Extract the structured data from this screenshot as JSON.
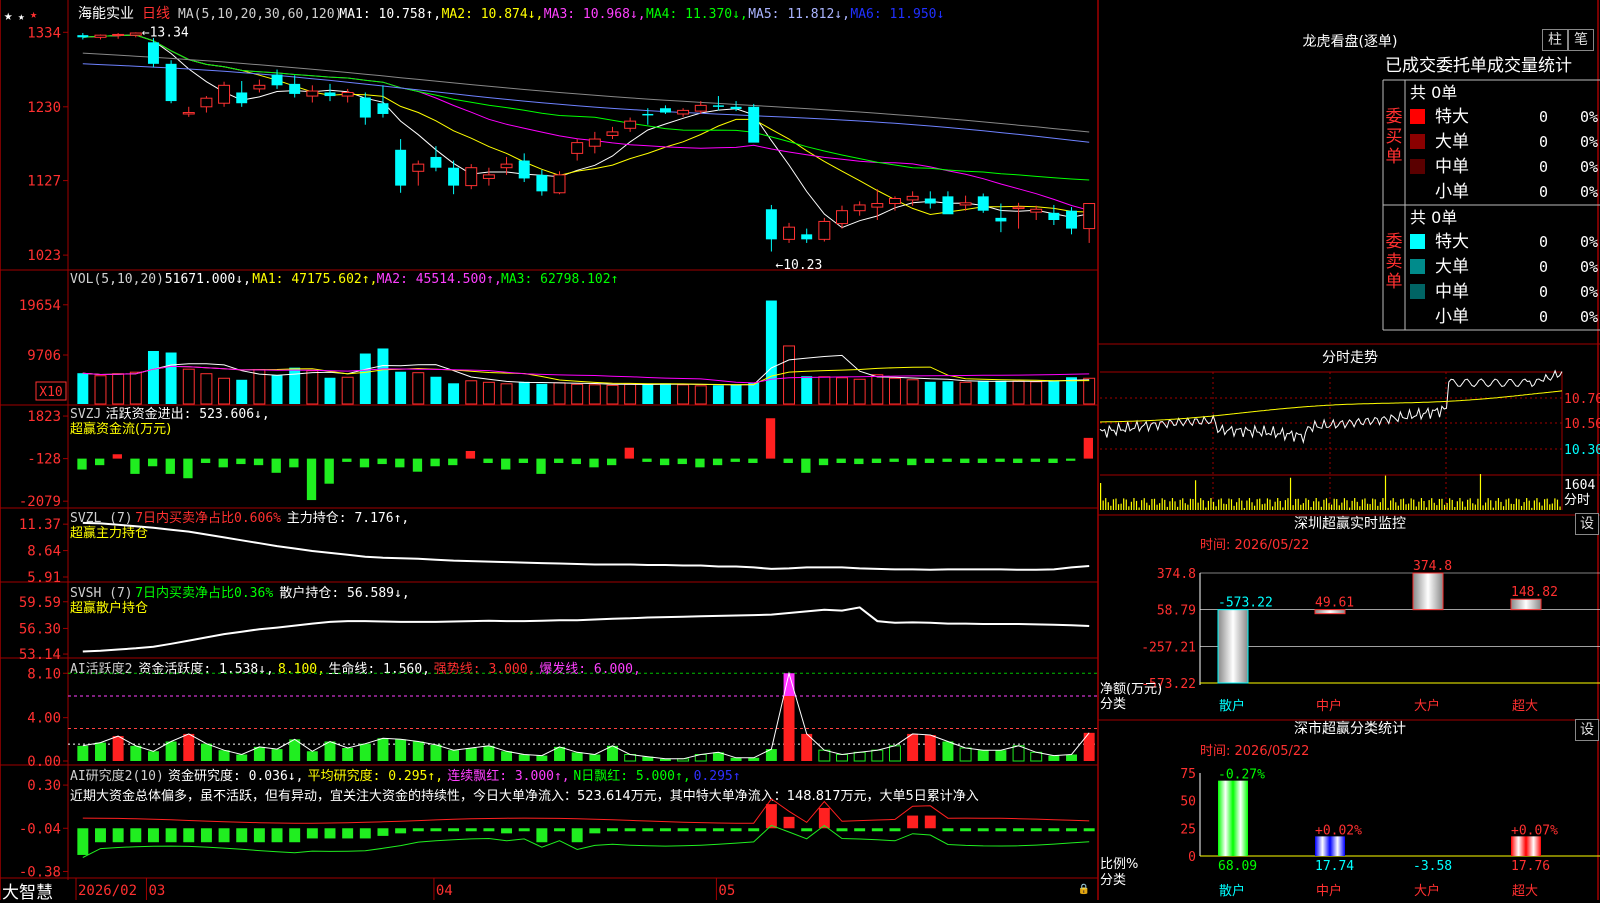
{
  "app": {
    "brand": "大智慧"
  },
  "stock": {
    "name": "海能实业",
    "period": "日线"
  },
  "colors": {
    "up": "#ff3232",
    "down": "#00ffff",
    "bg": "#000000",
    "grid": "#a00000",
    "ma1": "#ffffff",
    "ma2": "#ffff00",
    "ma3": "#ff00ff",
    "ma4": "#00ff00",
    "ma5": "#6e82ff",
    "ma6": "#888888"
  },
  "price_panel": {
    "header": [
      {
        "t": "MA(5,10,20,30,60,120)",
        "c": "#d0d0d0"
      },
      {
        "t": "MA1: 10.758↑,",
        "c": "#ffffff"
      },
      {
        "t": "MA2: 10.874↓,",
        "c": "#ffff00"
      },
      {
        "t": "MA3: 10.968↓,",
        "c": "#ff40ff"
      },
      {
        "t": "MA4: 11.370↓,",
        "c": "#00ff00"
      },
      {
        "t": "MA5: 11.812↓,",
        "c": "#aab4ff"
      },
      {
        "t": "MA6: 11.950↓",
        "c": "#2030ff"
      }
    ],
    "ticks": [
      "1334",
      "1230",
      "1127",
      "1023"
    ],
    "ymin": 10.05,
    "ymax": 13.4,
    "high_label": "13.34",
    "low_label": "←10.23"
  },
  "vol_panel": {
    "header": [
      {
        "t": "VOL(5,10,20)",
        "c": "#d0d0d0"
      },
      {
        "t": "51671.000↓,",
        "c": "#ffffff"
      },
      {
        "t": "MA1: 47175.602↑,",
        "c": "#ffff00"
      },
      {
        "t": "MA2: 45514.500↑,",
        "c": "#ff40ff"
      },
      {
        "t": "MA3: 62798.102↑",
        "c": "#00ff00"
      }
    ],
    "ticks": [
      "19654",
      "9706"
    ],
    "unit": "X10",
    "max": 21000
  },
  "svzj_panel": {
    "header": [
      {
        "t": "SVZJ",
        "c": "#d0d0d0"
      },
      {
        "t": "活跃资金进出: 523.606↓,",
        "c": "#ffffff"
      }
    ],
    "subtitle": "超赢资金流(万元)",
    "ticks": [
      "1823",
      "-128",
      "-2079"
    ],
    "min": -2300,
    "max": 2100
  },
  "svzl_panel": {
    "header": [
      {
        "t": "SVZL (7)",
        "c": "#d0d0d0"
      },
      {
        "t": "7日内买卖净占比0.606%",
        "c": "#ff3030"
      },
      {
        "t": "主力持仓: 7.176↑,",
        "c": "#ffffff"
      }
    ],
    "subtitle": "超赢主力持仓",
    "ticks": [
      "11.37",
      "8.64",
      "5.91"
    ],
    "min": 5.6,
    "max": 11.8
  },
  "svsh_panel": {
    "header": [
      {
        "t": "SVSH (7)",
        "c": "#d0d0d0"
      },
      {
        "t": "7日内买卖净占比0.36%",
        "c": "#00ff00"
      },
      {
        "t": "散户持仓: 56.589↓,",
        "c": "#ffffff"
      }
    ],
    "subtitle": "超赢散户持仓",
    "ticks": [
      "59.59",
      "56.30",
      "53.14"
    ],
    "min": 52.9,
    "max": 60.3
  },
  "ai_panel": {
    "header": [
      {
        "t": "AI活跃度2",
        "c": "#d0d0d0"
      },
      {
        "t": "资金活跃度: 1.538↓,",
        "c": "#ffffff"
      },
      {
        "t": "8.100,",
        "c": "#ffff00"
      },
      {
        "t": "生命线: 1.560,",
        "c": "#ffffff"
      },
      {
        "t": "强势线: 3.000,",
        "c": "#ff3030"
      },
      {
        "t": "爆发线: 6.000,",
        "c": "#ff40ff"
      }
    ],
    "ticks": [
      "8.10",
      "4.00",
      "0.00"
    ],
    "min": 0,
    "max": 8.4
  },
  "research_panel": {
    "header": [
      {
        "t": "AI研究度2(10)",
        "c": "#d0d0d0"
      },
      {
        "t": "资金研究度: 0.036↓,",
        "c": "#ffffff"
      },
      {
        "t": "平均研究度: 0.295↑,",
        "c": "#ffff00"
      },
      {
        "t": "连续飘红: 3.000↑,",
        "c": "#ff40ff"
      },
      {
        "t": "N日飘红: 5.000↑,",
        "c": "#00ff00"
      },
      {
        "t": "0.295↑",
        "c": "#3030ff"
      }
    ],
    "note": "近期大资金总体偏多，虽不活跃，但有异动，宜关注大资金的持续性，今日大单净流入：523.614万元，其中特大单净流入：148.817万元，大单5日累计净入",
    "ticks": [
      "0.30",
      "-0.04",
      "-0.38"
    ],
    "min": -0.4,
    "max": 0.34
  },
  "x_axis": {
    "labels": [
      {
        "t": "2026/02",
        "i": 0
      },
      {
        "t": "03",
        "i": 4
      },
      {
        "t": "04",
        "i": 20
      },
      {
        "t": "05",
        "i": 36
      }
    ]
  },
  "chart_data": {
    "type": "candlestick",
    "ohlc": [
      [
        13.3,
        13.33,
        13.24,
        13.27
      ],
      [
        13.27,
        13.31,
        13.24,
        13.3
      ],
      [
        13.3,
        13.33,
        13.25,
        13.31
      ],
      [
        13.3,
        13.34,
        13.27,
        13.33
      ],
      [
        13.2,
        13.26,
        12.85,
        12.9
      ],
      [
        12.9,
        12.95,
        12.35,
        12.38
      ],
      [
        12.2,
        12.3,
        12.16,
        12.22
      ],
      [
        12.3,
        12.45,
        12.22,
        12.42
      ],
      [
        12.35,
        12.65,
        12.3,
        12.6
      ],
      [
        12.5,
        12.66,
        12.3,
        12.35
      ],
      [
        12.55,
        12.68,
        12.5,
        12.6
      ],
      [
        12.75,
        12.82,
        12.55,
        12.6
      ],
      [
        12.62,
        12.74,
        12.43,
        12.48
      ],
      [
        12.45,
        12.6,
        12.36,
        12.52
      ],
      [
        12.5,
        12.62,
        12.38,
        12.45
      ],
      [
        12.45,
        12.55,
        12.36,
        12.5
      ],
      [
        12.43,
        12.5,
        12.05,
        12.15
      ],
      [
        12.35,
        12.6,
        12.15,
        12.2
      ],
      [
        11.7,
        11.85,
        11.1,
        11.2
      ],
      [
        11.4,
        11.55,
        11.2,
        11.5
      ],
      [
        11.6,
        11.75,
        11.4,
        11.45
      ],
      [
        11.45,
        11.55,
        11.08,
        11.2
      ],
      [
        11.2,
        11.5,
        11.15,
        11.45
      ],
      [
        11.3,
        11.45,
        11.2,
        11.35
      ],
      [
        11.45,
        11.6,
        11.35,
        11.5
      ],
      [
        11.55,
        11.65,
        11.25,
        11.3
      ],
      [
        11.35,
        11.42,
        11.06,
        11.12
      ],
      [
        11.1,
        11.4,
        11.08,
        11.35
      ],
      [
        11.65,
        11.85,
        11.55,
        11.8
      ],
      [
        11.75,
        11.95,
        11.65,
        11.85
      ],
      [
        11.9,
        12.02,
        11.85,
        11.95
      ],
      [
        12.0,
        12.15,
        11.95,
        12.1
      ],
      [
        12.2,
        12.28,
        12.05,
        12.18
      ],
      [
        12.28,
        12.32,
        12.2,
        12.22
      ],
      [
        12.2,
        12.28,
        12.16,
        12.25
      ],
      [
        12.24,
        12.38,
        12.2,
        12.32
      ],
      [
        12.32,
        12.45,
        12.25,
        12.3
      ],
      [
        12.3,
        12.38,
        12.24,
        12.27
      ],
      [
        12.3,
        12.34,
        11.85,
        11.8
      ],
      [
        10.87,
        10.93,
        10.28,
        10.45
      ],
      [
        10.45,
        10.68,
        10.4,
        10.62
      ],
      [
        10.52,
        10.6,
        10.4,
        10.45
      ],
      [
        10.45,
        10.75,
        10.42,
        10.7
      ],
      [
        10.67,
        10.92,
        10.6,
        10.85
      ],
      [
        10.85,
        10.98,
        10.78,
        10.93
      ],
      [
        10.9,
        11.15,
        10.72,
        10.95
      ],
      [
        10.95,
        11.05,
        10.85,
        11.02
      ],
      [
        11.0,
        11.12,
        10.92,
        11.05
      ],
      [
        11.02,
        11.12,
        10.88,
        10.95
      ],
      [
        11.05,
        11.12,
        10.82,
        10.8
      ],
      [
        10.93,
        11.06,
        10.85,
        10.96
      ],
      [
        11.05,
        11.09,
        10.82,
        10.85
      ],
      [
        10.75,
        10.95,
        10.55,
        10.7
      ],
      [
        10.88,
        10.96,
        10.6,
        10.9
      ],
      [
        10.83,
        10.92,
        10.72,
        10.87
      ],
      [
        10.82,
        10.93,
        10.65,
        10.72
      ],
      [
        10.85,
        10.9,
        10.52,
        10.6
      ],
      [
        10.6,
        10.95,
        10.4,
        10.95
      ]
    ],
    "volume": [
      6100,
      5600,
      6000,
      6300,
      10500,
      10200,
      6900,
      6000,
      5100,
      4800,
      6800,
      5700,
      7200,
      6600,
      5200,
      5300,
      10000,
      11000,
      6400,
      6200,
      5400,
      4100,
      4600,
      4300,
      4000,
      4400,
      4000,
      4200,
      3900,
      3800,
      3700,
      3900,
      4000,
      4100,
      3800,
      3600,
      3700,
      3800,
      4200,
      20500,
      11500,
      5500,
      5400,
      5200,
      4900,
      5800,
      5100,
      4800,
      4400,
      4500,
      4300,
      4600,
      4600,
      4500,
      4400,
      4700,
      5300,
      5100
    ],
    "svzj": [
      -500,
      -300,
      200,
      -700,
      -350,
      -700,
      -900,
      -200,
      -400,
      -250,
      -300,
      -650,
      -400,
      -1900,
      -1150,
      -150,
      -400,
      -250,
      -400,
      -600,
      -350,
      -300,
      350,
      -200,
      -500,
      -200,
      -700,
      -200,
      -250,
      -400,
      -300,
      500,
      -150,
      -300,
      -250,
      -400,
      -300,
      -150,
      -200,
      1850,
      -200,
      -650,
      -300,
      -200,
      -250,
      -200,
      -150,
      -300,
      -200,
      -150,
      -200,
      -200,
      -150,
      -200,
      -150,
      -200,
      -100,
      950,
      600
    ],
    "svzl": [
      11.5,
      11.45,
      11.3,
      11.15,
      11.0,
      10.8,
      10.6,
      10.3,
      10.0,
      9.7,
      9.4,
      9.1,
      8.85,
      8.6,
      8.4,
      8.2,
      8.0,
      7.9,
      7.85,
      7.8,
      7.7,
      7.6,
      7.55,
      7.5,
      7.45,
      7.4,
      7.35,
      7.3,
      7.25,
      7.2,
      7.2,
      7.2,
      7.15,
      7.15,
      7.1,
      7.1,
      7.0,
      7.0,
      6.9,
      6.75,
      6.8,
      6.9,
      6.9,
      6.9,
      6.8,
      6.75,
      6.7,
      6.7,
      6.65,
      6.7,
      6.7,
      6.7,
      6.7,
      6.65,
      6.65,
      6.7,
      6.9,
      7.05,
      7.18
    ],
    "svsh": [
      53.45,
      53.55,
      53.7,
      53.85,
      54.05,
      54.4,
      54.8,
      55.2,
      55.6,
      55.9,
      56.2,
      56.4,
      56.65,
      56.9,
      57.1,
      57.2,
      57.2,
      57.15,
      57.1,
      57.1,
      57.1,
      57.15,
      57.2,
      57.25,
      57.2,
      57.2,
      57.25,
      57.3,
      57.3,
      57.4,
      57.5,
      57.55,
      57.65,
      57.7,
      57.75,
      57.8,
      57.85,
      57.9,
      57.95,
      58.0,
      58.2,
      58.4,
      58.6,
      58.5,
      58.9,
      57.2,
      57.0,
      57.05,
      57.0,
      56.9,
      56.9,
      56.85,
      56.85,
      56.85,
      56.8,
      56.75,
      56.7,
      56.6
    ],
    "ai": [
      1.4,
      1.7,
      2.3,
      1.4,
      0.9,
      1.8,
      2.5,
      1.6,
      1.0,
      0.6,
      1.3,
      1.1,
      2.0,
      0.9,
      1.8,
      1.2,
      1.6,
      2.1,
      2.0,
      1.8,
      1.5,
      1.0,
      1.2,
      1.4,
      0.9,
      0.6,
      0.5,
      1.3,
      0.8,
      0.6,
      1.4,
      0.6,
      0.4,
      0.2,
      0.2,
      0.6,
      0.8,
      0.3,
      0.3,
      1.1,
      8.1,
      2.5,
      1.0,
      0.6,
      0.8,
      1.0,
      1.4,
      2.5,
      2.4,
      1.8,
      1.2,
      1.0,
      1.0,
      1.4,
      0.8,
      0.5,
      0.6,
      2.6,
      2.4,
      1.6
    ],
    "research": [
      -0.25,
      -0.15,
      -0.15,
      -0.15,
      -0.15,
      -0.15,
      -0.15,
      -0.15,
      -0.15,
      -0.15,
      -0.15,
      -0.15,
      -0.15,
      -0.12,
      -0.12,
      -0.12,
      -0.12,
      -0.1,
      -0.08,
      -0.05,
      -0.05,
      -0.05,
      -0.05,
      -0.05,
      -0.08,
      -0.05,
      -0.15,
      -0.05,
      -0.15,
      -0.08,
      -0.05,
      -0.05,
      -0.05,
      -0.05,
      -0.05,
      -0.05,
      -0.05,
      -0.05,
      -0.05,
      0.15,
      0.05,
      -0.05,
      0.12,
      -0.05,
      -0.05,
      -0.05,
      -0.05,
      0.06,
      0.06,
      -0.05,
      -0.05,
      -0.05,
      -0.05,
      -0.05,
      -0.05,
      -0.05,
      -0.05,
      -0.05,
      0.2,
      0.15
    ]
  },
  "dragon_tiger": {
    "title": "龙虎看盘(逐单)",
    "btn_bar": "柱",
    "btn_pen": "笔",
    "subtitle": "已成交委托单成交量统计",
    "buy": {
      "label": "委买单",
      "count": "共 0单",
      "rows": [
        {
          "name": "特大",
          "vol": "0",
          "pct": "0%",
          "color": "#ff0000"
        },
        {
          "name": "大单",
          "vol": "0",
          "pct": "0%",
          "color": "#8b0000"
        },
        {
          "name": "中单",
          "vol": "0",
          "pct": "0%",
          "color": "#5a0000"
        },
        {
          "name": "小单",
          "vol": "0",
          "pct": "0%",
          "color": "#000000"
        }
      ]
    },
    "sell": {
      "label": "委卖单",
      "count": "共 0单",
      "rows": [
        {
          "name": "特大",
          "vol": "0",
          "pct": "0%",
          "color": "#00ffff"
        },
        {
          "name": "大单",
          "vol": "0",
          "pct": "0%",
          "color": "#008b8b"
        },
        {
          "name": "中单",
          "vol": "0",
          "pct": "0%",
          "color": "#006464"
        },
        {
          "name": "小单",
          "vol": "0",
          "pct": "0%",
          "color": "#000000"
        }
      ]
    }
  },
  "intraday": {
    "title": "分时走势",
    "prices": [
      "10.70",
      "10.50",
      "10.30"
    ],
    "vol_label": "1604",
    "vol_label2": "分时"
  },
  "sz_realtime": {
    "title": "深圳超赢实时监控",
    "btn": "设",
    "time": "时间: 2026/05/22",
    "ticks": [
      "374.8",
      "58.79",
      "-257.21",
      "-573.22"
    ],
    "ylabel": "净额(万元)",
    "xlabel": "分类",
    "cats": [
      "散户",
      "中户",
      "大户",
      "超大"
    ],
    "values": [
      "-573.22",
      "49.61",
      "374.8",
      "148.82"
    ]
  },
  "sz_class": {
    "title": "深市超赢分类统计",
    "btn": "设",
    "time": "时间: 2026/05/22",
    "ticks": [
      "75",
      "50",
      "25",
      "0"
    ],
    "ylabel": "比例%",
    "xlabel": "分类",
    "cats": [
      "散户",
      "中户",
      "大户",
      "超大"
    ],
    "top_labels": [
      "-0.27%",
      "+0.02%",
      "",
      "+0.07%"
    ],
    "values": [
      "68.09",
      "17.74",
      "-3.58",
      "17.76"
    ]
  }
}
